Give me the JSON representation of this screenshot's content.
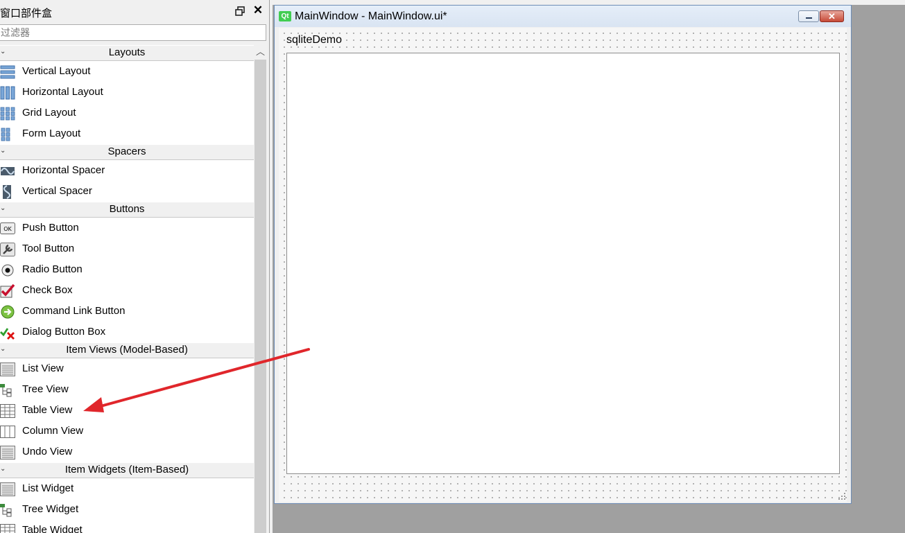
{
  "widget_box": {
    "title": "窗口部件盒",
    "filter_placeholder": "过滤器",
    "categories": [
      {
        "label": "Layouts",
        "items": [
          {
            "label": "Vertical Layout",
            "icon": "vertical-layout-icon"
          },
          {
            "label": "Horizontal Layout",
            "icon": "horizontal-layout-icon"
          },
          {
            "label": "Grid Layout",
            "icon": "grid-layout-icon"
          },
          {
            "label": "Form Layout",
            "icon": "form-layout-icon"
          }
        ]
      },
      {
        "label": "Spacers",
        "items": [
          {
            "label": "Horizontal Spacer",
            "icon": "horizontal-spacer-icon"
          },
          {
            "label": "Vertical Spacer",
            "icon": "vertical-spacer-icon"
          }
        ]
      },
      {
        "label": "Buttons",
        "items": [
          {
            "label": "Push Button",
            "icon": "push-button-icon"
          },
          {
            "label": "Tool Button",
            "icon": "tool-button-icon"
          },
          {
            "label": "Radio Button",
            "icon": "radio-button-icon"
          },
          {
            "label": "Check Box",
            "icon": "check-box-icon"
          },
          {
            "label": "Command Link Button",
            "icon": "command-link-icon"
          },
          {
            "label": "Dialog Button Box",
            "icon": "dialog-button-box-icon"
          }
        ]
      },
      {
        "label": "Item Views (Model-Based)",
        "items": [
          {
            "label": "List View",
            "icon": "list-view-icon"
          },
          {
            "label": "Tree View",
            "icon": "tree-view-icon"
          },
          {
            "label": "Table View",
            "icon": "table-view-icon"
          },
          {
            "label": "Column View",
            "icon": "column-view-icon"
          },
          {
            "label": "Undo View",
            "icon": "undo-view-icon"
          }
        ]
      },
      {
        "label": "Item Widgets (Item-Based)",
        "items": [
          {
            "label": "List Widget",
            "icon": "list-widget-icon"
          },
          {
            "label": "Tree Widget",
            "icon": "tree-widget-icon"
          },
          {
            "label": "Table Widget",
            "icon": "table-widget-icon"
          }
        ]
      }
    ]
  },
  "form_window": {
    "title": "MainWindow - MainWindow.ui*",
    "app_icon_text": "Qt",
    "menu_item": "sqliteDemo"
  },
  "annotation": {
    "color": "#e0262b",
    "points_to": "Table View"
  },
  "colors": {
    "qt_green": "#41cd52",
    "close_red": "#c74a37"
  }
}
